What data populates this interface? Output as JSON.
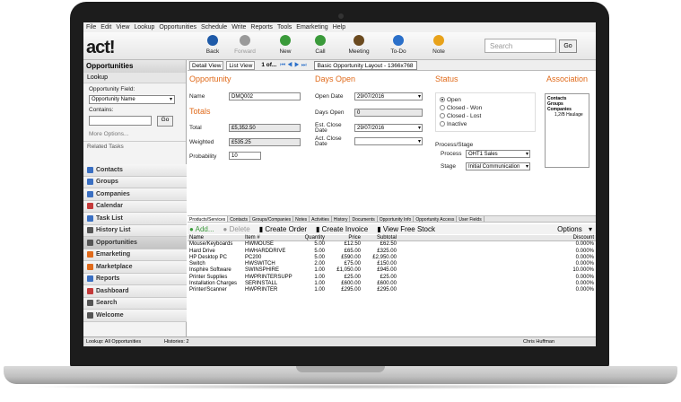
{
  "menu": [
    "File",
    "Edit",
    "View",
    "Lookup",
    "Opportunities",
    "Schedule",
    "Write",
    "Reports",
    "Tools",
    "Emarketing",
    "Help"
  ],
  "logo": "act!",
  "toolbar": [
    {
      "label": "Back",
      "icon": "back-arrow-icon",
      "color": "#1e5aa8",
      "enabled": true
    },
    {
      "label": "Forward",
      "icon": "forward-arrow-icon",
      "color": "#999999",
      "enabled": false
    },
    {
      "label": "New",
      "icon": "new-icon",
      "color": "#3a9a3a",
      "enabled": true
    },
    {
      "label": "Call",
      "icon": "phone-icon",
      "color": "#3a9a3a",
      "enabled": true
    },
    {
      "label": "Meeting",
      "icon": "meeting-icon",
      "color": "#6b4a1f",
      "enabled": true
    },
    {
      "label": "To-Do",
      "icon": "todo-icon",
      "color": "#2a6fc9",
      "enabled": true
    },
    {
      "label": "Note",
      "icon": "note-icon",
      "color": "#e8a21a",
      "enabled": true
    }
  ],
  "search": {
    "placeholder": "Search",
    "go": "Go"
  },
  "sidebar": {
    "title": "Opportunities",
    "lookup_head": "Lookup",
    "field_label": "Opportunity Field:",
    "field_value": "Opportunity Name",
    "contains_label": "Contains:",
    "go": "Go",
    "more": "More Options...",
    "related": "Related Tasks",
    "nav": [
      {
        "label": "Contacts",
        "color": "#3a6fc2"
      },
      {
        "label": "Groups",
        "color": "#3a6fc2"
      },
      {
        "label": "Companies",
        "color": "#3a6fc2"
      },
      {
        "label": "Calendar",
        "color": "#c43a3a"
      },
      {
        "label": "Task List",
        "color": "#3a6fc2"
      },
      {
        "label": "History List",
        "color": "#555555"
      },
      {
        "label": "Opportunities",
        "color": "#555555"
      },
      {
        "label": "Emarketing",
        "color": "#e06a1a"
      },
      {
        "label": "Marketplace",
        "color": "#e06a1a"
      },
      {
        "label": "Reports",
        "color": "#3a6fc2"
      },
      {
        "label": "Dashboard",
        "color": "#c43a3a"
      },
      {
        "label": "Search",
        "color": "#555555"
      },
      {
        "label": "Welcome",
        "color": "#555555"
      }
    ]
  },
  "viewbar": {
    "detail": "Detail View",
    "list": "List View",
    "record": "1 of...",
    "layout": "Basic Opportunity Layout - 1366x768"
  },
  "opportunity": {
    "heading": "Opportunity",
    "name_label": "Name",
    "name_value": "DMQ002",
    "totals_heading": "Totals",
    "total_label": "Total",
    "total_value": "£5,352.50",
    "weighted_label": "Weighted",
    "weighted_value": "£535.25",
    "prob_label": "Probability",
    "prob_value": "10"
  },
  "days": {
    "heading": "Days Open",
    "open_date_label": "Open Date",
    "open_date_value": "29/07/2016",
    "days_open_label": "Days Open",
    "days_open_value": "0",
    "est_close_label": "Est. Close Date",
    "est_close_value": "29/07/2016",
    "act_close_label": "Act. Close Date",
    "act_close_value": ""
  },
  "status": {
    "heading": "Status",
    "options": [
      "Open",
      "Closed - Won",
      "Closed - Lost",
      "Inactive"
    ],
    "selected": "Open",
    "process_heading": "Process/Stage",
    "process_label": "Process",
    "process_value": "OHT1 Sales",
    "stage_label": "Stage",
    "stage_value": "Initial Communication"
  },
  "association": {
    "heading": "Association",
    "items": [
      "Contacts",
      "Groups",
      "Companies"
    ],
    "company_sub": "1,2/B Haulage"
  },
  "tabs": [
    "Products/Services",
    "Contacts",
    "Groups/Companies",
    "Notes",
    "Activities",
    "History",
    "Documents",
    "Opportunity Info",
    "Opportunity Access",
    "User Fields"
  ],
  "gridbar": {
    "add": "Add...",
    "delete": "Delete",
    "create_order": "Create Order",
    "create_invoice": "Create Invoice",
    "view_stock": "View Free Stock",
    "options": "Options"
  },
  "grid": {
    "headers": [
      "Name",
      "Item #",
      "Quantity",
      "Price",
      "Subtotal",
      "Discount"
    ],
    "rows": [
      [
        "Mouse/Keyboards",
        "HWMOUSE",
        "5.00",
        "£12.50",
        "£62.50",
        "0.000%"
      ],
      [
        "Hard Drive",
        "HWHARDDRIVE",
        "5.00",
        "£65.00",
        "£325.00",
        "0.000%"
      ],
      [
        "HP Desktop PC",
        "PC200",
        "5.00",
        "£590.00",
        "£2,950.00",
        "0.000%"
      ],
      [
        "Switch",
        "HWSWITCH",
        "2.00",
        "£75.00",
        "£150.00",
        "0.000%"
      ],
      [
        "Insphire Software",
        "SWINSPHIRE",
        "1.00",
        "£1,050.00",
        "£945.00",
        "10.000%"
      ],
      [
        "Printer Supplies",
        "HWPRINTERSUPP",
        "1.00",
        "£25.00",
        "£25.00",
        "0.000%"
      ],
      [
        "Installation Charges",
        "SERINSTALL",
        "1.00",
        "£600.00",
        "£600.00",
        "0.000%"
      ],
      [
        "Printer/Scanner",
        "HWPRINTER",
        "1.00",
        "£295.00",
        "£295.00",
        "0.000%"
      ]
    ]
  },
  "statusbar": {
    "lookup": "Lookup: All Opportunities",
    "histories": "Histories: 2",
    "user": "Chris Huffman"
  }
}
